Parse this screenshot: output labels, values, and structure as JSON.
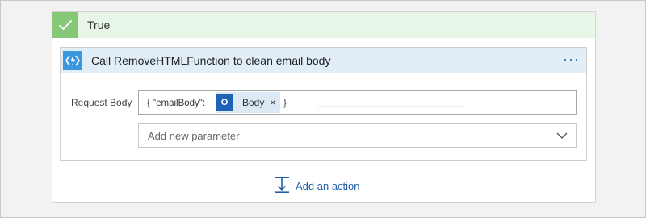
{
  "condition": {
    "branch_label": "True"
  },
  "action": {
    "title": "Call RemoveHTMLFunction to clean email body",
    "menu_label": "···",
    "request_body": {
      "label": "Request Body",
      "prefix": "{ \"emailBody\":",
      "token": {
        "label": "Body",
        "close": "×",
        "icon": "outlook-icon",
        "icon_text": "O"
      },
      "suffix": "}"
    },
    "add_parameter": {
      "placeholder": "Add new parameter"
    }
  },
  "footer": {
    "add_action_label": "Add an action"
  },
  "colors": {
    "true_header_bg": "#e8f6e8",
    "check_bg": "#86c878",
    "action_header_bg": "#e1eef8",
    "function_icon_bg": "#3a96dd",
    "outlook_icon_bg": "#1f62b8",
    "link_blue": "#1f5fa8"
  },
  "icons": {
    "check": "check-icon",
    "function": "azure-function-icon",
    "chevron": "chevron-down-icon",
    "add_action": "add-action-icon"
  }
}
